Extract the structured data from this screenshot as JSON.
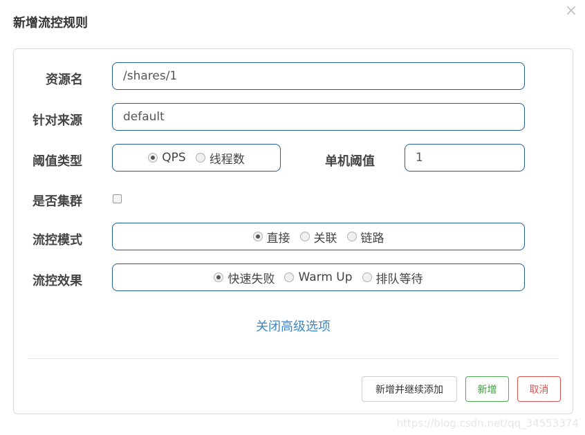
{
  "dialog": {
    "title": "新增流控规则",
    "close_symbol": "×"
  },
  "form": {
    "resource_name": {
      "label": "资源名",
      "value": "/shares/1"
    },
    "limit_app": {
      "label": "针对来源",
      "value": "default"
    },
    "threshold_type": {
      "label": "阈值类型",
      "options": [
        "QPS",
        "线程数"
      ],
      "selected": "QPS"
    },
    "single_threshold": {
      "label": "单机阈值",
      "value": "1"
    },
    "cluster_mode": {
      "label": "是否集群",
      "checked": false
    },
    "flow_mode": {
      "label": "流控模式",
      "options": [
        "直接",
        "关联",
        "链路"
      ],
      "selected": "直接"
    },
    "flow_effect": {
      "label": "流控效果",
      "options": [
        "快速失败",
        "Warm Up",
        "排队等待"
      ],
      "selected": "快速失败"
    },
    "advanced_toggle": "关闭高级选项"
  },
  "footer": {
    "add_continue_label": "新增并继续添加",
    "add_label": "新增",
    "cancel_label": "取消"
  },
  "watermark": "https://blog.csdn.net/qq_34553374",
  "colors": {
    "input_border": "#1f5d96",
    "link": "#3a87c7",
    "success": "#4cae4c",
    "danger": "#d9534f"
  }
}
